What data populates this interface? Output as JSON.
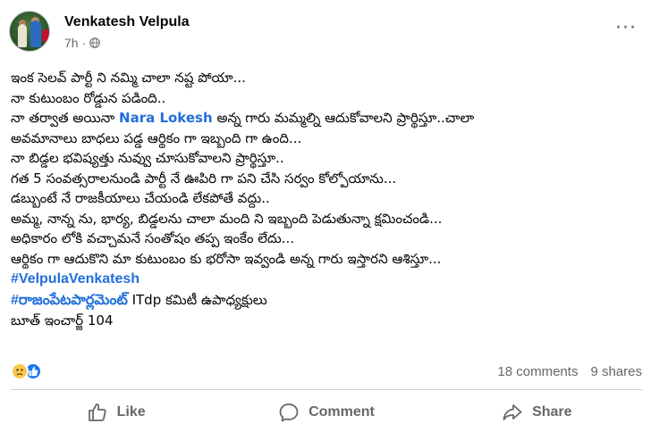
{
  "post": {
    "author": "Venkatesh Velpula",
    "time": "7h",
    "separator": "·",
    "more_label": "···",
    "privacy_icon": "globe-icon",
    "lines": [
      "ఇంక సెలవ్ పార్టీ ని నమ్మి చాలా నష్ట పోయా...",
      "నా కుటుంబం రోడ్డున పడింది..",
      {
        "before": "నా తర్వాత అయినా ",
        "tag": "Nara Lokesh",
        "after": "  అన్న గారు మమ్మల్ని ఆదుకోవాలని ప్రార్థిస్తూ..చాలా"
      },
      "అవమానాలు బాధలు పడ్డ ఆర్థికం గా ఇబ్బంది గా ఉంది...",
      "నా బిడ్డల భవిష్యత్తు నువ్వు చూసుకోవాలని ప్రార్థిస్తూ..",
      "గత 5 సంవత్సరాలనుండి పార్టీ నే ఊపిరి గా పని చేసి సర్వం కోల్పోయాను...",
      "డబ్బుంటే నే రాజకీయాలు చేయండి లేకపోతే  వద్దు..",
      "అమ్మ, నాన్న ను, భార్య, బిడ్డలను చాలా మంది ని ఇబ్బంది పెడుతున్నా క్షమించండి...",
      "అధికారం లోకి వచ్చామనే సంతోషం తప్ప ఇంకేం లేదు...",
      "ఆర్థికం గా ఆదుకొని మా కుటుంబం కు భరోసా ఇవ్వండి అన్న గారు ఇస్తారని ఆశిస్తూ..."
    ],
    "hashtag_1": "#VelpulaVenkatesh",
    "hashtag_2": "#రాజంపేటపార్లమెంట్",
    "hashtag_2_suffix": " ITdp కమిటీ ఉపాధ్యక్షులు",
    "last_line": "బూత్ ఇంచార్జ్ 104"
  },
  "stats": {
    "reactions": [
      "sad-icon",
      "like-icon"
    ],
    "comments": "18 comments",
    "shares": "9 shares"
  },
  "actions": {
    "like_label": "Like",
    "comment_label": "Comment",
    "share_label": "Share"
  },
  "colors": {
    "link_blue": "#216fdb",
    "muted_text": "#65676b",
    "like_blue": "#1877f2",
    "sad_yellow": "#f7c94a"
  }
}
